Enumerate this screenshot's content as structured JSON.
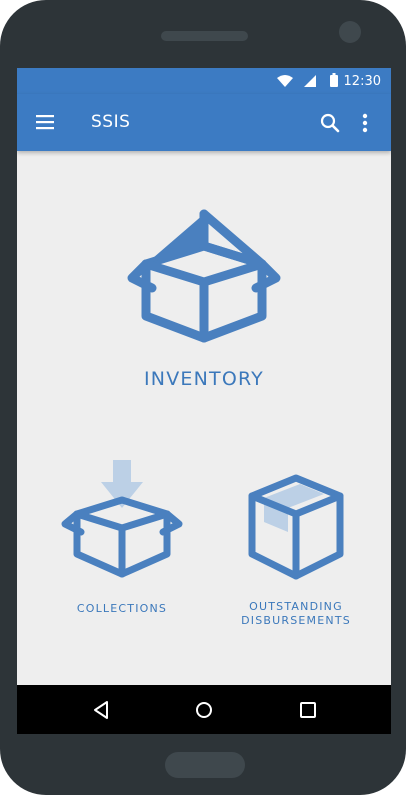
{
  "status": {
    "time": "12:30"
  },
  "appbar": {
    "title": "SSIS"
  },
  "tiles": {
    "inventory": "INVENTORY",
    "collections": "COLLECTIONS",
    "outstanding_line1": "OUTSTANDING",
    "outstanding_line2": "DISBURSEMENTS"
  },
  "colors": {
    "primary": "#3c7bc3",
    "icon": "#4a80bf",
    "icon_light": "#bcd0e6",
    "screen_bg": "#eeeeee"
  },
  "icons": [
    "menu-icon",
    "search-icon",
    "more-vert-icon",
    "box-icon",
    "download-arrow-icon",
    "taped-box-icon",
    "back-icon",
    "home-icon",
    "recents-icon",
    "wifi-icon",
    "signal-icon",
    "battery-icon"
  ]
}
